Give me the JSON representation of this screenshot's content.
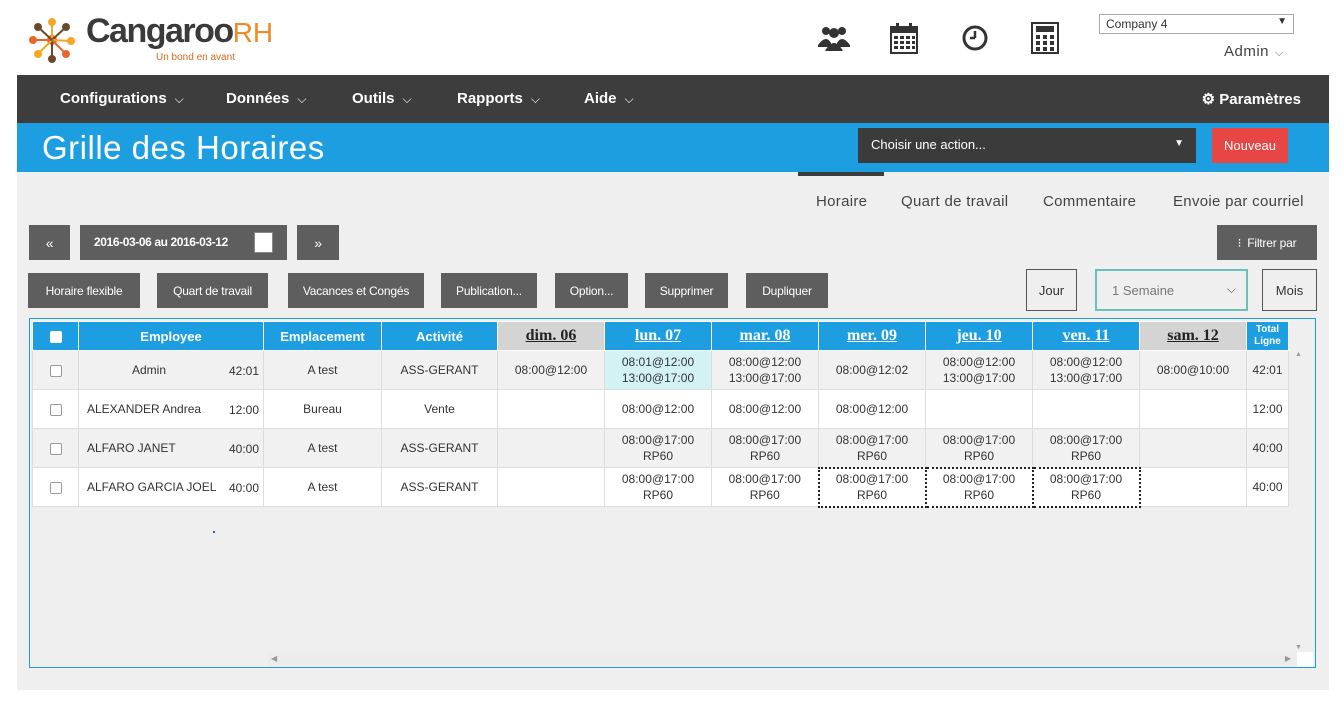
{
  "brand": {
    "name": "Cangaroo",
    "suffix": "RH",
    "tagline": "Un bond en avant"
  },
  "header": {
    "icons": [
      "users-icon",
      "calendar-icon",
      "clock-icon",
      "calculator-icon"
    ],
    "company": "Company 4",
    "user": "Admin"
  },
  "nav": {
    "items": [
      "Configurations",
      "Données",
      "Outils",
      "Rapports",
      "Aide"
    ],
    "settings": "Paramètres"
  },
  "title": "Grille des Horaires",
  "actions": {
    "placeholder": "Choisir une action...",
    "new": "Nouveau"
  },
  "tabs": [
    "Horaire",
    "Quart de travail",
    "Commentaire",
    "Envoie par courriel"
  ],
  "toolbar": {
    "prev": "«",
    "range": "2016-03-06 au 2016-03-12",
    "next": "»",
    "filter": "Filtrer par",
    "buttons": [
      "Horaire flexible",
      "Quart de travail",
      "Vacances et Congés",
      "Publication...",
      "Option...",
      "Supprimer",
      "Dupliquer"
    ],
    "views": {
      "day": "Jour",
      "week": "1 Semaine",
      "month": "Mois"
    }
  },
  "grid": {
    "headers": {
      "employee": "Employee",
      "location": "Emplacement",
      "activity": "Activité",
      "total": "Total Ligne"
    },
    "days": [
      "dim. 06",
      "lun. 07",
      "mar. 08",
      "mer. 09",
      "jeu. 10",
      "ven. 11",
      "sam. 12"
    ],
    "rows": [
      {
        "name": "Admin",
        "hours": "42:01",
        "location": "A test",
        "activity": "ASS-GERANT",
        "cells": [
          "08:00@12:00",
          "08:01@12:00\n13:00@17:00",
          "08:00@12:00\n13:00@17:00",
          "08:00@12:02",
          "08:00@12:00\n13:00@17:00",
          "08:00@12:00\n13:00@17:00",
          "08:00@10:00"
        ],
        "total": "42:01"
      },
      {
        "name": "ALEXANDER Andrea",
        "hours": "12:00",
        "location": "Bureau",
        "activity": "Vente",
        "cells": [
          "",
          "08:00@12:00",
          "08:00@12:00",
          "08:00@12:00",
          "",
          "",
          ""
        ],
        "total": "12:00"
      },
      {
        "name": "ALFARO JANET",
        "hours": "40:00",
        "location": "A test",
        "activity": "ASS-GERANT",
        "cells": [
          "",
          "08:00@17:00\nRP60",
          "08:00@17:00\nRP60",
          "08:00@17:00\nRP60",
          "08:00@17:00\nRP60",
          "08:00@17:00\nRP60",
          ""
        ],
        "total": "40:00"
      },
      {
        "name": "ALFARO GARCIA JOEL",
        "hours": "40:00",
        "location": "A test",
        "activity": "ASS-GERANT",
        "cells": [
          "",
          "08:00@17:00\nRP60",
          "08:00@17:00\nRP60",
          "08:00@17:00\nRP60",
          "08:00@17:00\nRP60",
          "08:00@17:00\nRP60",
          ""
        ],
        "total": "40:00"
      }
    ]
  },
  "colors": {
    "accent": "#1d9ee0",
    "nav": "#3d3d3d",
    "danger": "#e84545",
    "highlight": "#d3f2f4",
    "brand_orange": "#f08a24"
  }
}
